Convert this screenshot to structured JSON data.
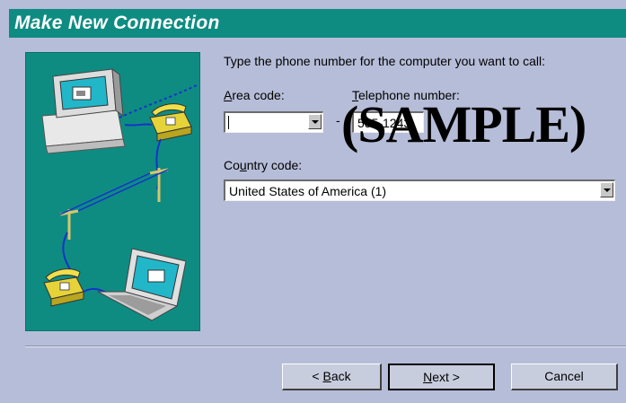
{
  "window": {
    "title": "Make New Connection"
  },
  "main": {
    "prompt": "Type the phone number for the computer you want to call:",
    "area_code": {
      "label_prefix": "",
      "label_mnemonic": "A",
      "label_rest": "rea code:",
      "value": ""
    },
    "telephone_number": {
      "label_prefix": "",
      "label_mnemonic": "T",
      "label_rest": "elephone number:",
      "value": "555-1243"
    },
    "separator": "-",
    "country_code": {
      "label_prefix": "Co",
      "label_mnemonic": "u",
      "label_rest": "ntry code:",
      "value": "United States of America (1)"
    },
    "watermark": "(SAMPLE)"
  },
  "buttons": {
    "back": {
      "prefix": "< ",
      "mnemonic": "B",
      "rest": "ack"
    },
    "next": {
      "prefix": "",
      "mnemonic": "N",
      "rest": "ext >"
    },
    "cancel": {
      "label": "Cancel"
    }
  },
  "colors": {
    "title_bar": "#0e8c82",
    "dialog_bg": "#b6bdd8",
    "illustration_bg": "#0e8c82"
  },
  "icons": {
    "illustration": "computer-phone-network-illustration",
    "dropdown": "chevron-down-icon"
  }
}
